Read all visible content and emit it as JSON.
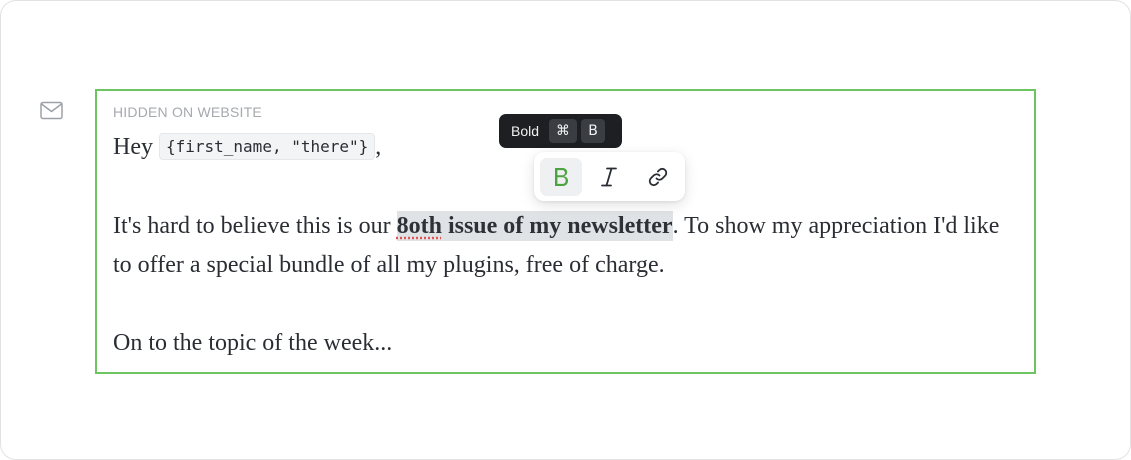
{
  "card": {
    "label": "HIDDEN ON WEBSITE"
  },
  "content": {
    "greeting_prefix": "Hey ",
    "merge_tag": "{first_name, \"there\"}",
    "greeting_suffix": ",",
    "para2_before": "It's hard to believe this is our ",
    "para2_selected_first_word": "8oth",
    "para2_selected_rest": " issue of my newsletter",
    "para2_after": ". To show my appreciation I'd like to offer a special bundle of all my plugins, free of charge.",
    "para3": "On to the topic of the week..."
  },
  "tooltip": {
    "label": "Bold",
    "key_modifier": "⌘",
    "key_letter": "B"
  },
  "toolbar": {
    "bold_glyph": "B",
    "icons": [
      "bold-icon",
      "italic-icon",
      "link-icon"
    ]
  },
  "colors": {
    "accent_green": "#6cc560",
    "bold_active": "#4aa53e",
    "tooltip_bg": "#1d1f22",
    "selection_bg": "#e0e3e6"
  }
}
